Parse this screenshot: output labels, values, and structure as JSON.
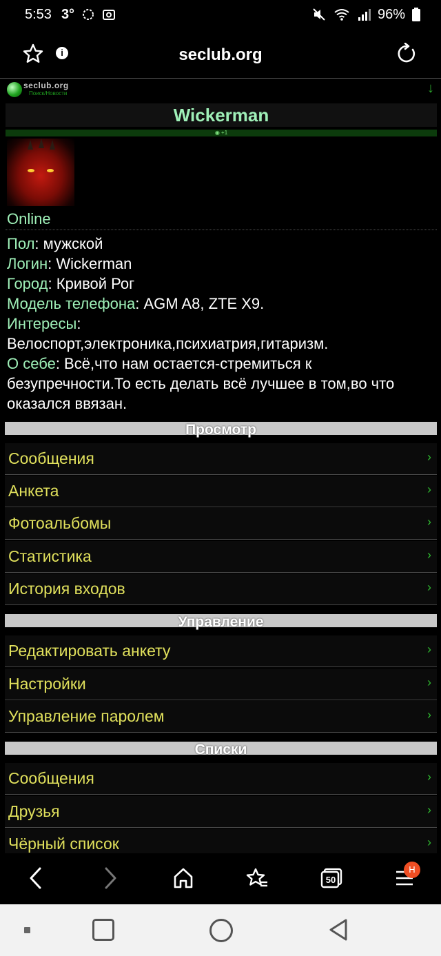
{
  "status_bar": {
    "time": "5:53",
    "temperature": "3°",
    "battery": "96%"
  },
  "browser": {
    "url": "seclub.org"
  },
  "site": {
    "logo_text": "seclub.org",
    "logo_subtext": "Поиск/Новости"
  },
  "profile": {
    "name": "Wickerman",
    "rating": "+1",
    "status": "Online",
    "fields": [
      {
        "key": "Пол",
        "value": "мужской"
      },
      {
        "key": "Логин",
        "value": "Wickerman"
      },
      {
        "key": "Город",
        "value": "Кривой Рог"
      },
      {
        "key": "Модель телефона",
        "value": "AGM A8, ZTE X9."
      },
      {
        "key": "Интересы",
        "value": "Велоспорт,электроника,психиатрия,гитаризм."
      },
      {
        "key": "О себе",
        "value": "Всё,что нам остается-стремиться к безупречности.То есть делать всё лучшее в том,во что оказался ввязан."
      }
    ]
  },
  "sections": [
    {
      "title": "Просмотр",
      "items": [
        "Сообщения",
        "Анкета",
        "Фотоальбомы",
        "Статистика",
        "История входов"
      ]
    },
    {
      "title": "Управление",
      "items": [
        "Редактировать анкету",
        "Настройки",
        "Управление паролем"
      ]
    },
    {
      "title": "Списки",
      "items": [
        "Сообщения",
        "Друзья",
        "Чёрный список"
      ]
    }
  ],
  "bottom_nav": {
    "tabs_count": "50",
    "menu_badge": "H"
  },
  "colors": {
    "label_green": "#9ff0b8",
    "menu_yellow": "#e0e05c",
    "chevron_green": "#2fb82f",
    "section_gray": "#c8c8c8"
  }
}
